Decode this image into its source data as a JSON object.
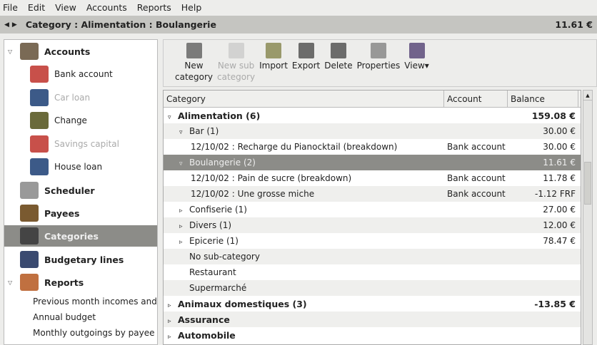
{
  "menu": [
    "File",
    "Edit",
    "View",
    "Accounts",
    "Reports",
    "Help"
  ],
  "title": {
    "path": "Category : Alimentation : Boulangerie",
    "amount": "11.61 €"
  },
  "sidebar": {
    "items": [
      {
        "label": "Accounts",
        "level": "top",
        "icon": "house-icon",
        "expanded": true
      },
      {
        "label": "Bank account",
        "level": "sub",
        "icon": "bank-icon"
      },
      {
        "label": "Car loan",
        "level": "sub",
        "icon": "book-icon",
        "disabled": true
      },
      {
        "label": "Change",
        "level": "sub",
        "icon": "money-icon"
      },
      {
        "label": "Savings capital",
        "level": "sub",
        "icon": "bank-icon",
        "disabled": true
      },
      {
        "label": "House loan",
        "level": "sub",
        "icon": "book-icon"
      },
      {
        "label": "Scheduler",
        "level": "top",
        "icon": "clock-icon"
      },
      {
        "label": "Payees",
        "level": "top",
        "icon": "people-icon"
      },
      {
        "label": "Categories",
        "level": "top",
        "icon": "barcode-icon",
        "selected": true
      },
      {
        "label": "Budgetary lines",
        "level": "top",
        "icon": "chart-icon"
      },
      {
        "label": "Reports",
        "level": "top",
        "icon": "report-icon",
        "expanded": true
      }
    ],
    "reports": [
      "Previous month incomes and",
      "Annual budget",
      "Monthly outgoings by payee"
    ]
  },
  "toolbar": [
    {
      "l1": "New",
      "l2": "category",
      "icon": "new-category-icon"
    },
    {
      "l1": "New sub",
      "l2": "category",
      "icon": "new-sub-category-icon",
      "disabled": true
    },
    {
      "l1": "Import",
      "l2": "",
      "icon": "folder-icon"
    },
    {
      "l1": "Export",
      "l2": "",
      "icon": "floppy-icon"
    },
    {
      "l1": "Delete",
      "l2": "",
      "icon": "trash-icon"
    },
    {
      "l1": "Properties",
      "l2": "",
      "icon": "properties-icon"
    },
    {
      "l1": "View",
      "l2": "",
      "icon": "view-icon"
    }
  ],
  "table": {
    "headers": [
      "Category",
      "Account",
      "Balance"
    ],
    "rows": [
      {
        "ind": 0,
        "exp": "▿",
        "cat": "Alimentation (6)",
        "acc": "",
        "bal": "159.08 €",
        "bold": true
      },
      {
        "ind": 1,
        "exp": "▿",
        "cat": "Bar (1)",
        "acc": "",
        "bal": "30.00 €"
      },
      {
        "ind": 2,
        "exp": "",
        "cat": "12/10/02 : Recharge du Pianocktail (breakdown)",
        "acc": "Bank account",
        "bal": "30.00 €"
      },
      {
        "ind": 1,
        "exp": "▿",
        "cat": "Boulangerie (2)",
        "acc": "",
        "bal": "11.61 €",
        "sel": true
      },
      {
        "ind": 2,
        "exp": "",
        "cat": "12/10/02 : Pain de sucre (breakdown)",
        "acc": "Bank account",
        "bal": "11.78 €"
      },
      {
        "ind": 2,
        "exp": "",
        "cat": "12/10/02 : Une grosse miche",
        "acc": "Bank account",
        "bal": "-1.12 FRF"
      },
      {
        "ind": 1,
        "exp": "▹",
        "cat": "Confiserie (1)",
        "acc": "",
        "bal": "27.00 €"
      },
      {
        "ind": 1,
        "exp": "▹",
        "cat": "Divers (1)",
        "acc": "",
        "bal": "12.00 €"
      },
      {
        "ind": 1,
        "exp": "▹",
        "cat": "Epicerie (1)",
        "acc": "",
        "bal": "78.47 €"
      },
      {
        "ind": 1,
        "exp": "",
        "cat": "No sub-category",
        "acc": "",
        "bal": ""
      },
      {
        "ind": 1,
        "exp": "",
        "cat": "Restaurant",
        "acc": "",
        "bal": ""
      },
      {
        "ind": 1,
        "exp": "",
        "cat": "Supermarché",
        "acc": "",
        "bal": ""
      },
      {
        "ind": 0,
        "exp": "▹",
        "cat": "Animaux domestiques (3)",
        "acc": "",
        "bal": "-13.85 €",
        "bold": true
      },
      {
        "ind": 0,
        "exp": "▹",
        "cat": "Assurance",
        "acc": "",
        "bal": "",
        "bold": true
      },
      {
        "ind": 0,
        "exp": "▹",
        "cat": "Automobile",
        "acc": "",
        "bal": "",
        "bold": true
      }
    ]
  }
}
